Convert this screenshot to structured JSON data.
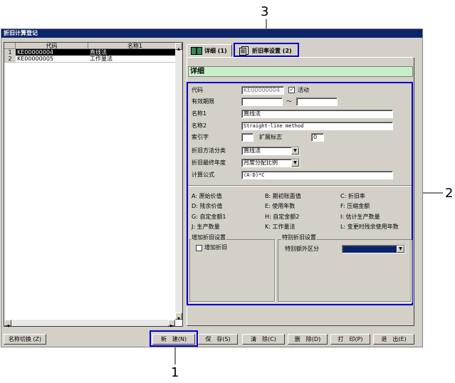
{
  "window": {
    "title": "折旧计算登记"
  },
  "list": {
    "headers": [
      "代码",
      "名称1"
    ],
    "rows": [
      {
        "num": "1",
        "code": "KE00000004",
        "name": "直线法"
      },
      {
        "num": "2",
        "code": "KE00000005",
        "name": "工作量法"
      }
    ]
  },
  "tabs": [
    {
      "label": "详细 (1)"
    },
    {
      "label": "折旧率设置 (2)"
    }
  ],
  "panel": {
    "title": "详细"
  },
  "form": {
    "code_label": "代码",
    "code_value": "KE00000004",
    "active_label": "活动",
    "active_checked": true,
    "validity_label": "有效期限",
    "validity_sep": "～",
    "name1_label": "名称1",
    "name1_value": "直线法",
    "name2_label": "名称2",
    "name2_value": "Straight-line method",
    "index_label": "索引字",
    "ext_label": "扩展标志",
    "ext_value": "0",
    "method_label": "折旧方法分类",
    "method_value": "直线法",
    "final_year_label": "折旧最终年度",
    "final_year_value": "月度分配比例",
    "formula_label": "计算公式",
    "formula_value": "(A-D)*C"
  },
  "legend": [
    [
      "A: 原始价值",
      "B: 期初账面值",
      "C: 折旧率"
    ],
    [
      "D: 残余价值",
      "E: 使用年数",
      "F: 压缩金额"
    ],
    [
      "G: 自定金额1",
      "H: 自定金额2",
      "I: 估计生产数量"
    ],
    [
      "J: 生产数量",
      "K: 工作量法",
      "L: 变更时残余使用年数"
    ]
  ],
  "add_group": {
    "title": "增加折旧设置",
    "checkbox_label": "增加折旧"
  },
  "special_group": {
    "title": "特别折旧设置",
    "label": "特别额外区分"
  },
  "buttons": {
    "switch_name": "名称切换 (Z)",
    "new": "新　建(N)",
    "save": "保　存(S)",
    "clear": "清　除(C)",
    "delete": "删　除(D)",
    "print": "打　印(P)",
    "exit": "退　出(E)"
  },
  "callouts": {
    "c1": "1",
    "c2": "2",
    "c3": "3"
  },
  "colors": {
    "titlebar": "#0a246a",
    "panel_header": "#c8f0c8",
    "callout": "#0000cc",
    "selection": "#000000"
  }
}
